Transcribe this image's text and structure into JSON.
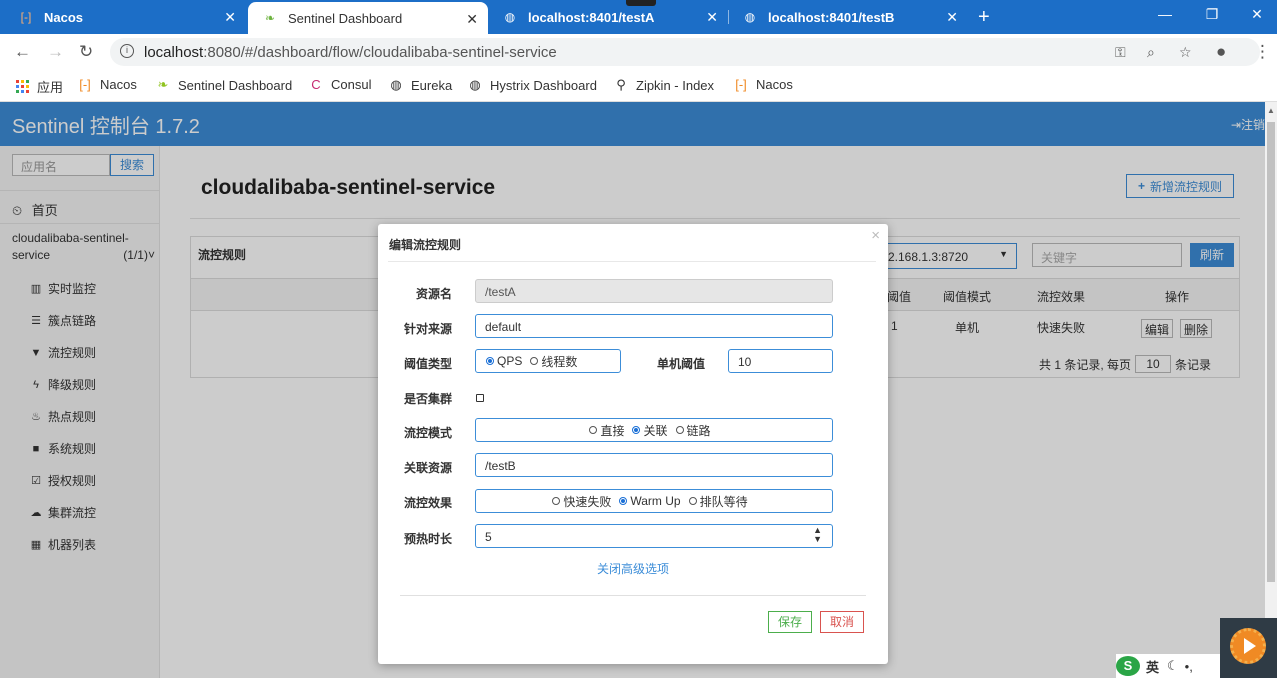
{
  "browser": {
    "tabs": [
      {
        "title": "Nacos",
        "icon": "nacos-icon",
        "active": false
      },
      {
        "title": "Sentinel Dashboard",
        "icon": "leaf-icon",
        "active": true
      },
      {
        "title": "localhost:8401/testA",
        "icon": "globe-icon",
        "active": false
      },
      {
        "title": "localhost:8401/testB",
        "icon": "globe-icon",
        "active": false
      }
    ],
    "url_host": "localhost",
    "url_rest": ":8080/#/dashboard/flow/cloudalibaba-sentinel-service",
    "bookmarks": [
      {
        "label": "应用",
        "icon": "apps-icon"
      },
      {
        "label": "Nacos",
        "icon": "nacos-icon"
      },
      {
        "label": "Sentinel Dashboard",
        "icon": "leaf-icon"
      },
      {
        "label": "Consul",
        "icon": "consul-icon"
      },
      {
        "label": "Eureka",
        "icon": "globe-icon"
      },
      {
        "label": "Hystrix Dashboard",
        "icon": "globe-icon"
      },
      {
        "label": "Zipkin - Index",
        "icon": "zipkin-icon"
      },
      {
        "label": "Nacos",
        "icon": "nacos-icon"
      }
    ],
    "tab_bar_color": "#1c6ec7"
  },
  "app": {
    "brand": "Sentinel 控制台 1.7.2",
    "logout": "注销",
    "header_color": "#3c8dd8"
  },
  "sidebar": {
    "search_placeholder": "应用名",
    "search_button": "搜索",
    "home": "首页",
    "app_name": "cloudalibaba-sentinel-service",
    "app_count": "(1/1)",
    "items": [
      {
        "label": "实时监控",
        "icon": "bar-chart-icon"
      },
      {
        "label": "簇点链路",
        "icon": "list-icon"
      },
      {
        "label": "流控规则",
        "icon": "filter-icon"
      },
      {
        "label": "降级规则",
        "icon": "flash-icon"
      },
      {
        "label": "热点规则",
        "icon": "fire-icon"
      },
      {
        "label": "系统规则",
        "icon": "lock-icon"
      },
      {
        "label": "授权规则",
        "icon": "check-icon"
      },
      {
        "label": "集群流控",
        "icon": "cloud-icon"
      },
      {
        "label": "机器列表",
        "icon": "table-icon"
      }
    ]
  },
  "main": {
    "title": "cloudalibaba-sentinel-service",
    "add_rule_button": "新增流控规则",
    "panel_title": "流控规则",
    "machine_select": "2.168.1.3:8720",
    "keyword_placeholder": "关键字",
    "refresh_button": "刷新",
    "table_headers": [
      "阈值",
      "阈值模式",
      "流控效果",
      "操作"
    ],
    "row": {
      "threshold": "1",
      "mode": "单机",
      "effect": "快速失败",
      "edit": "编辑",
      "delete": "删除"
    },
    "pager_prefix": "共 1 条记录, 每页",
    "page_size": "10",
    "pager_suffix": "条记录"
  },
  "modal": {
    "title": "编辑流控规则",
    "labels": {
      "resource": "资源名",
      "origin": "针对来源",
      "threshold_type": "阈值类型",
      "single_threshold": "单机阈值",
      "cluster": "是否集群",
      "mode": "流控模式",
      "ref_resource": "关联资源",
      "effect": "流控效果",
      "warmup": "预热时长"
    },
    "values": {
      "resource": "/testA",
      "origin": "default",
      "single_threshold": "10",
      "ref_resource": "/testB",
      "warmup": "5"
    },
    "threshold_type_options": [
      {
        "label": "QPS",
        "selected": true
      },
      {
        "label": "线程数",
        "selected": false
      }
    ],
    "mode_options": [
      {
        "label": "直接",
        "selected": false
      },
      {
        "label": "关联",
        "selected": true
      },
      {
        "label": "链路",
        "selected": false
      }
    ],
    "effect_options": [
      {
        "label": "快速失败",
        "selected": false
      },
      {
        "label": "Warm Up",
        "selected": true
      },
      {
        "label": "排队等待",
        "selected": false
      }
    ],
    "cluster_checked": false,
    "advanced_link": "关闭高级选项",
    "save_button": "保存",
    "cancel_button": "取消"
  },
  "taskbar": {
    "ime_lang": "英"
  }
}
